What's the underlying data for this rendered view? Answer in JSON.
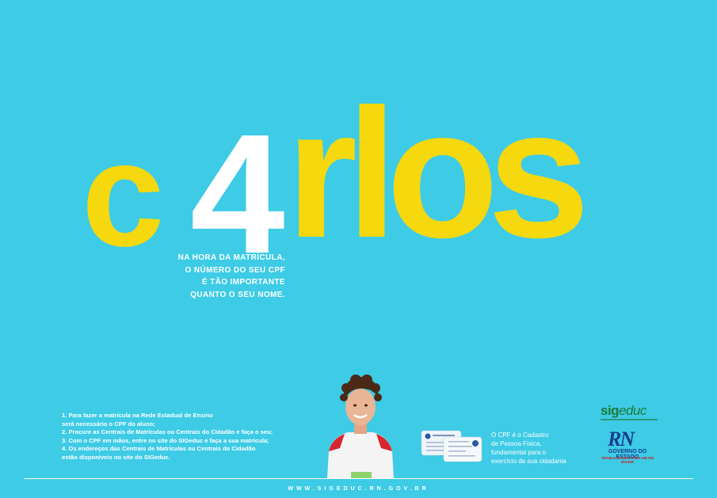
{
  "headline": {
    "letter_c": "c",
    "digit": "4",
    "rest": "rlos",
    "color_yellow": "#f5d80e",
    "color_white": "#ffffff"
  },
  "tagline": {
    "lines": [
      "NA HORA DA MATRÍCULA,",
      "O NÚMERO DO SEU CPF",
      "É TÃO IMPORTANTE",
      "QUANTO O SEU NOME."
    ]
  },
  "steps": {
    "lines": [
      "1. Para fazer a matrícula na Rede Estadual de Ensino",
      "será necessário o CPF do aluno;",
      "2. Procure as Centrais de Matrículas ou Centrais do Cidadão e faça o seu;",
      "3. Com o CPF em mãos, entre no site do SIGeduc e faça a sua matrícula;",
      "4. Os endereços das Centrais de Matrículas ou Centrais do Cidadão",
      "estão disponíveis no site do SIGeduc."
    ]
  },
  "cpf_note": {
    "lines": [
      "O CPF é o Cadastro",
      "de Pessoa Física,",
      "fundamental para o",
      "exercício da sua cidadania"
    ]
  },
  "logos": {
    "sig_prefix": "sig",
    "sig_suffix": "educ",
    "rn_mark": "RN",
    "rn_line1": "GOVERNO DO ESTADO",
    "rn_line2": "TRABALHANDO POR UM RN MAIOR"
  },
  "footer": {
    "url": "WWW.SIGEDUC.RN.GOV.BR"
  },
  "colors": {
    "background": "#3dcbe6",
    "sig_green": "#1d7a35",
    "rn_blue": "#1a3d8f",
    "rn_red": "#c8202a"
  }
}
